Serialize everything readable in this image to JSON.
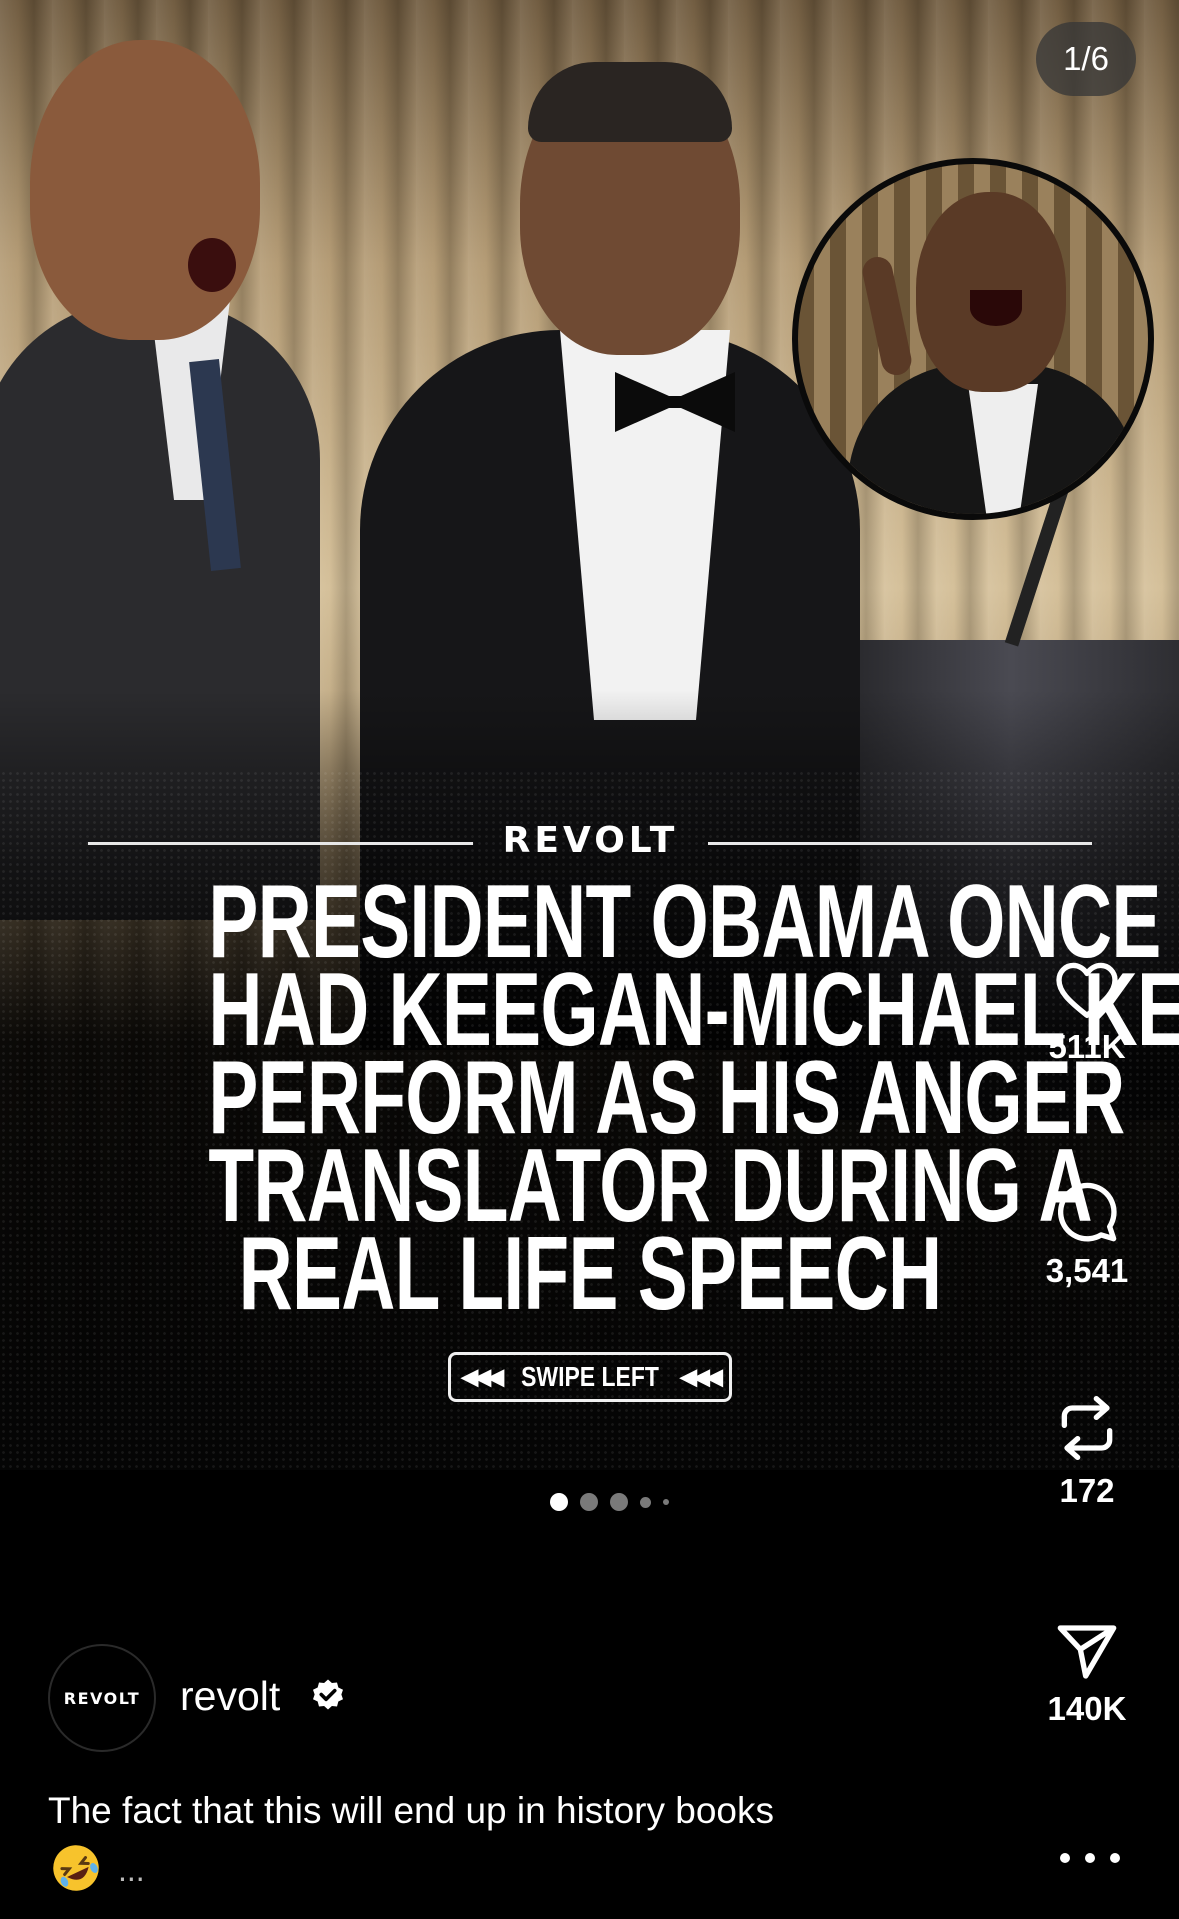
{
  "post": {
    "image_counter": "1/6",
    "brand": "REVOLT",
    "headline_lines": [
      "PRESIDENT OBAMA ONCE",
      "HAD KEEGAN-MICHAEL KEY",
      "PERFORM AS HIS ANGER",
      "TRANSLATOR DURING A",
      "REAL LIFE SPEECH"
    ],
    "swipe_arrows": "◀◀◀",
    "swipe_label": "SWIPE LEFT",
    "carousel": {
      "total_dots": 5,
      "active_index": 0
    }
  },
  "actions": {
    "likes": "511K",
    "comments": "3,541",
    "reposts": "172",
    "shares": "140K"
  },
  "author": {
    "avatar_text": "REVOLT",
    "username": "revolt",
    "verified": true
  },
  "caption": {
    "text": "The fact that this will end up in history books",
    "emoji_icon": "rolling-on-floor-laughing-emoji",
    "truncation": "..."
  },
  "colors": {
    "background": "#000000",
    "text": "#ffffff",
    "dot_inactive": "#7a7a7a"
  }
}
